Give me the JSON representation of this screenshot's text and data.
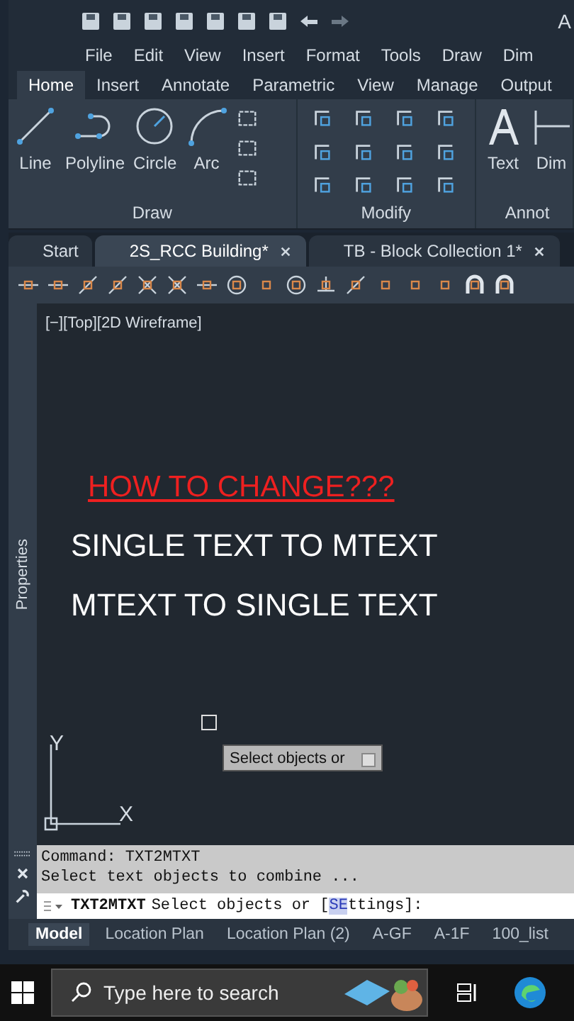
{
  "title_bar": {
    "title": "A"
  },
  "menu_bar": [
    "File",
    "Edit",
    "View",
    "Insert",
    "Format",
    "Tools",
    "Draw",
    "Dim"
  ],
  "ribbon_tabs": [
    {
      "label": "Home",
      "selected": true
    },
    {
      "label": "Insert",
      "selected": false
    },
    {
      "label": "Annotate",
      "selected": false
    },
    {
      "label": "Parametric",
      "selected": false
    },
    {
      "label": "View",
      "selected": false
    },
    {
      "label": "Manage",
      "selected": false
    },
    {
      "label": "Output",
      "selected": false
    }
  ],
  "ribbon_panels": [
    {
      "title": "Draw",
      "kind": "draw",
      "tools": [
        "Line",
        "Polyline",
        "Circle",
        "Arc"
      ]
    },
    {
      "title": "Modify",
      "kind": "modify"
    },
    {
      "title": "Annot",
      "kind": "annotation",
      "tools": [
        "Text",
        "Dim"
      ]
    }
  ],
  "doc_tabs": [
    {
      "label": "Start",
      "selected": false,
      "closable": false
    },
    {
      "label": "2S_RCC Building*",
      "selected": true,
      "closable": true
    },
    {
      "label": "TB - Block Collection 1*",
      "selected": false,
      "closable": true
    }
  ],
  "viewport": {
    "controls": "[−][Top][2D Wireframe]",
    "palette": "Properties"
  },
  "canvas_texts": [
    {
      "text": "HOW TO CHANGE???",
      "kind": "heading"
    },
    {
      "text": "SINGLE TEXT TO MTEXT",
      "kind": "body"
    },
    {
      "text": "MTEXT TO SINGLE TEXT",
      "kind": "body"
    }
  ],
  "ucs": {
    "x": "X",
    "y": "Y"
  },
  "tooltip": "Select objects or",
  "command_history": [
    "Command: TXT2MTXT",
    "Select text objects to combine ..."
  ],
  "command_line": {
    "command": "TXT2MTXT",
    "before": "Select objects or [",
    "option_key": "SE",
    "option_rest": "ttings",
    "after": "]:"
  },
  "layout_tabs": [
    {
      "label": "Model",
      "selected": true
    },
    {
      "label": "Location Plan",
      "selected": false
    },
    {
      "label": "Location Plan (2)",
      "selected": false
    },
    {
      "label": "A-GF",
      "selected": false
    },
    {
      "label": "A-1F",
      "selected": false
    },
    {
      "label": "100_list",
      "selected": false
    }
  ],
  "taskbar": {
    "search_placeholder": "Type here to search"
  }
}
